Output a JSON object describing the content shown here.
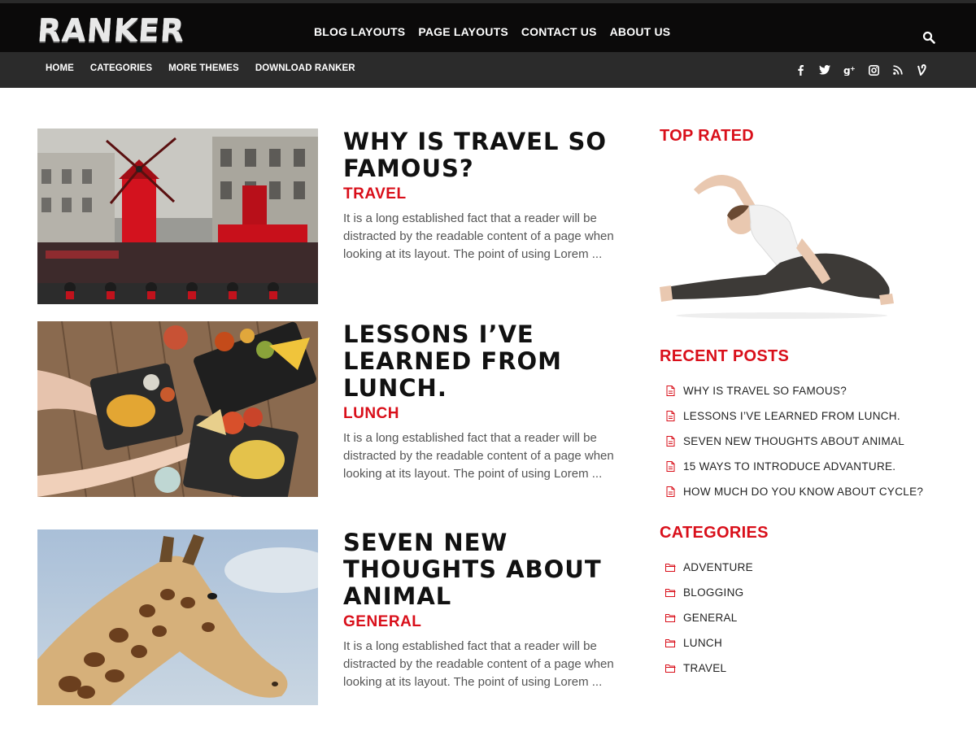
{
  "header": {
    "logo_text": "RANKER",
    "nav": [
      "BLOG LAYOUTS",
      "PAGE LAYOUTS",
      "CONTACT US",
      "ABOUT US"
    ],
    "search_icon": "search-icon"
  },
  "subnav": {
    "items": [
      "HOME",
      "CATEGORIES",
      "MORE THEMES",
      "DOWNLOAD RANKER"
    ],
    "social": [
      {
        "name": "facebook-icon",
        "glyph": "f"
      },
      {
        "name": "twitter-icon",
        "glyph": "t"
      },
      {
        "name": "google-plus-icon",
        "glyph": "g+"
      },
      {
        "name": "instagram-icon",
        "glyph": "ig"
      },
      {
        "name": "rss-icon",
        "glyph": "rss"
      },
      {
        "name": "vine-icon",
        "glyph": "v"
      }
    ]
  },
  "posts": [
    {
      "title": "WHY IS TRAVEL SO FAMOUS?",
      "category": "TRAVEL",
      "excerpt": "It is a long established fact that a reader will be distracted by the readable content of a page when looking at its layout. The point of using Lorem ..."
    },
    {
      "title": "LESSONS I’VE LEARNED FROM LUNCH.",
      "category": "LUNCH",
      "excerpt": "It is a long established fact that a reader will be distracted by the readable content of a page when looking at its layout. The point of using Lorem ..."
    },
    {
      "title": "SEVEN NEW THOUGHTS ABOUT ANIMAL",
      "category": "GENERAL",
      "excerpt": "It is a long established fact that a reader will be distracted by the readable content of a page when looking at its layout. The point of using Lorem ..."
    }
  ],
  "sidebar": {
    "top_rated_title": "TOP RATED",
    "recent_title": "RECENT POSTS",
    "recent": [
      "WHY IS TRAVEL SO FAMOUS?",
      "LESSONS I’VE LEARNED FROM LUNCH.",
      "SEVEN NEW THOUGHTS ABOUT ANIMAL",
      "15 WAYS TO INTRODUCE ADVANTURE.",
      "HOW MUCH DO YOU KNOW ABOUT CYCLE?"
    ],
    "categories_title": "CATEGORIES",
    "categories": [
      "ADVENTURE",
      "BLOGGING",
      "GENERAL",
      "LUNCH",
      "TRAVEL"
    ]
  },
  "colors": {
    "accent": "#d90f1a",
    "header_bg": "#0b0a0a",
    "subbar_bg": "#2b2b2b"
  }
}
